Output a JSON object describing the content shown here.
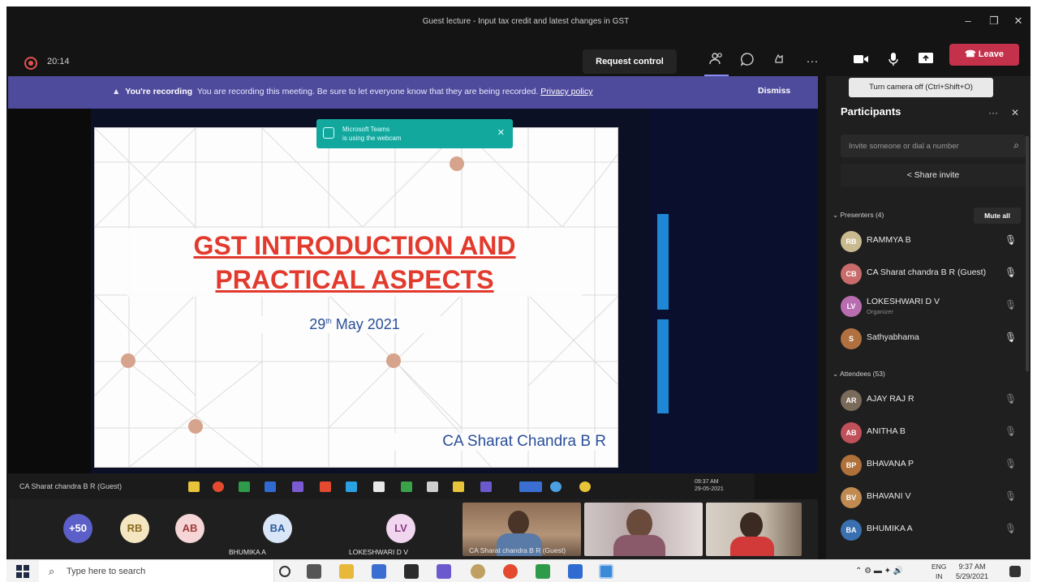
{
  "window": {
    "title": "Guest lecture - Input tax credit and latest changes in GST",
    "minimize_glyph": "–",
    "maximize_glyph": "❐",
    "close_glyph": "✕"
  },
  "toolbar": {
    "timer": "20:14",
    "request_control": "Request control",
    "more_glyph": "···",
    "leave": "Leave",
    "leave_icon": "phone-hangup-icon"
  },
  "tooltip": "Turn camera off (Ctrl+Shift+O)",
  "recording_banner": {
    "bold": "You're recording",
    "message": "You are recording this meeting. Be sure to let everyone know that they are being recorded.",
    "link": "Privacy policy",
    "dismiss": "Dismiss"
  },
  "share_notice": {
    "line1": "Microsoft Teams",
    "line2": "is using the webcam"
  },
  "slide": {
    "title_line1": "GST INTRODUCTION AND",
    "title_line2": "PRACTICAL ASPECTS",
    "date_day": "29",
    "date_suffix": "th",
    "date_rest": "May 2021",
    "author": "CA Sharat Chandra B R",
    "colors": {
      "title": "#e23a2d",
      "text": "#2a4f9a",
      "dot": "#d6a48c"
    }
  },
  "shared_taskbar": {
    "presenter_label": "CA Sharat chandra B R (Guest)",
    "clock_time": "09:37 AM",
    "clock_date": "29-05-2021"
  },
  "gallery": {
    "overflow_count": "+50",
    "tiles": [
      {
        "initials": "RB",
        "name": "",
        "bg": "#f4e6c0",
        "fg": "#8a6a20"
      },
      {
        "initials": "AB",
        "name": "",
        "bg": "#f5d5d5",
        "fg": "#a23a3a"
      },
      {
        "initials": "BA",
        "name": "BHUMIKA A",
        "bg": "#d8e6f7",
        "fg": "#2d5b9a"
      },
      {
        "initials": "LV",
        "name": "LOKESHWARI D V",
        "bg": "#f0d6ee",
        "fg": "#8a3a86"
      }
    ],
    "video_label": "CA Sharat chandra B R (Guest)"
  },
  "participants": {
    "title": "Participants",
    "more_glyph": "···",
    "close_glyph": "✕",
    "invite_placeholder": "Invite someone or dial a number",
    "share_invite": "Share invite",
    "presenters_label": "Presenters (4)",
    "mute_all": "Mute all",
    "presenters": [
      {
        "initials": "RB",
        "name": "RAMMYA B",
        "sub": "",
        "bg": "#c9b98f",
        "mic": "on"
      },
      {
        "initials": "CB",
        "name": "CA Sharat chandra B R (Guest)",
        "sub": "",
        "bg": "#c96b6b",
        "mic": "on"
      },
      {
        "initials": "LV",
        "name": "LOKESHWARI D V",
        "sub": "Organizer",
        "bg": "#b86db0",
        "mic": "off"
      },
      {
        "initials": "S",
        "name": "Sathyabhama",
        "sub": "",
        "bg": "#b07040",
        "mic": "on"
      }
    ],
    "attendees_label": "Attendees (53)",
    "attendees": [
      {
        "initials": "AR",
        "name": "AJAY RAJ R",
        "bg": "#7a6a5a",
        "mic": "off"
      },
      {
        "initials": "AB",
        "name": "ANITHA B",
        "bg": "#c0505a",
        "mic": "off"
      },
      {
        "initials": "BP",
        "name": "BHAVANA P",
        "bg": "#b0703a",
        "mic": "off"
      },
      {
        "initials": "BV",
        "name": "BHAVANI V",
        "bg": "#c08a50",
        "mic": "off"
      },
      {
        "initials": "BA",
        "name": "BHUMIKA A",
        "bg": "#3a6fb0",
        "mic": "off"
      }
    ]
  },
  "win_taskbar": {
    "search_placeholder": "Type here to search",
    "lang": "ENG",
    "region": "IN",
    "time": "9:37 AM",
    "date": "5/29/2021"
  }
}
